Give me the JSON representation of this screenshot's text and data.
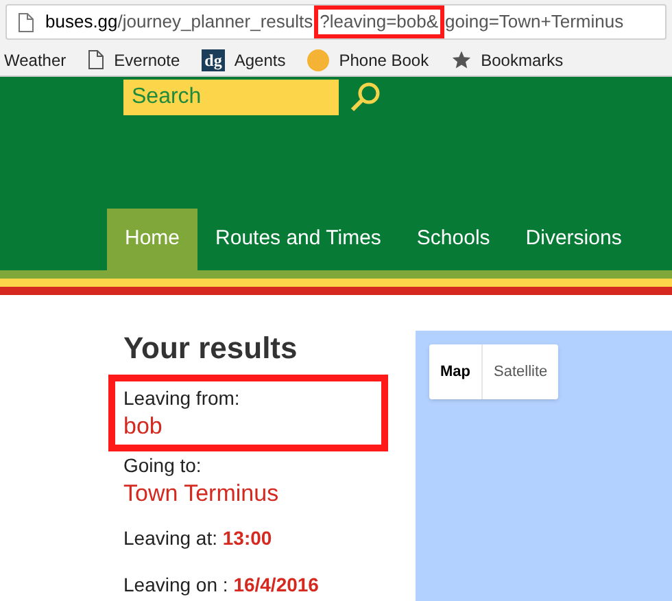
{
  "address_bar": {
    "url_parts": [
      {
        "text": "buses.gg",
        "highlighted": false,
        "kind": "host"
      },
      {
        "text": "/journey_planner_results",
        "highlighted": false,
        "kind": "path"
      },
      {
        "text": "?leaving=bob&",
        "highlighted": true,
        "kind": "path"
      },
      {
        "text": "going=Town+Terminus",
        "highlighted": false,
        "kind": "path"
      }
    ]
  },
  "bookmarks": [
    {
      "label": "Weather",
      "kind": "plain"
    },
    {
      "label": "Evernote",
      "kind": "page"
    },
    {
      "label": "Agents",
      "kind": "badge",
      "badge": "dg"
    },
    {
      "label": "Phone Book",
      "kind": "dot"
    },
    {
      "label": "Bookmarks",
      "kind": "star"
    }
  ],
  "search": {
    "placeholder": "Search"
  },
  "nav": [
    {
      "label": "Home",
      "selected": true
    },
    {
      "label": "Routes and Times",
      "selected": false
    },
    {
      "label": "Schools",
      "selected": false
    },
    {
      "label": "Diversions",
      "selected": false
    }
  ],
  "results": {
    "title": "Your results",
    "fields": [
      {
        "label": "Leaving from:",
        "value": "bob",
        "kind": "stacked",
        "highlighted": true
      },
      {
        "label": "Going to:",
        "value": "Town Terminus",
        "kind": "stacked",
        "highlighted": false
      },
      {
        "label": "Leaving at:",
        "value": "13:00",
        "kind": "inline",
        "highlighted": false
      },
      {
        "label": "Leaving on :",
        "value": "16/4/2016",
        "kind": "inline",
        "highlighted": false
      }
    ]
  },
  "map": {
    "types": [
      {
        "label": "Map",
        "selected": true
      },
      {
        "label": "Satellite",
        "selected": false
      }
    ]
  }
}
